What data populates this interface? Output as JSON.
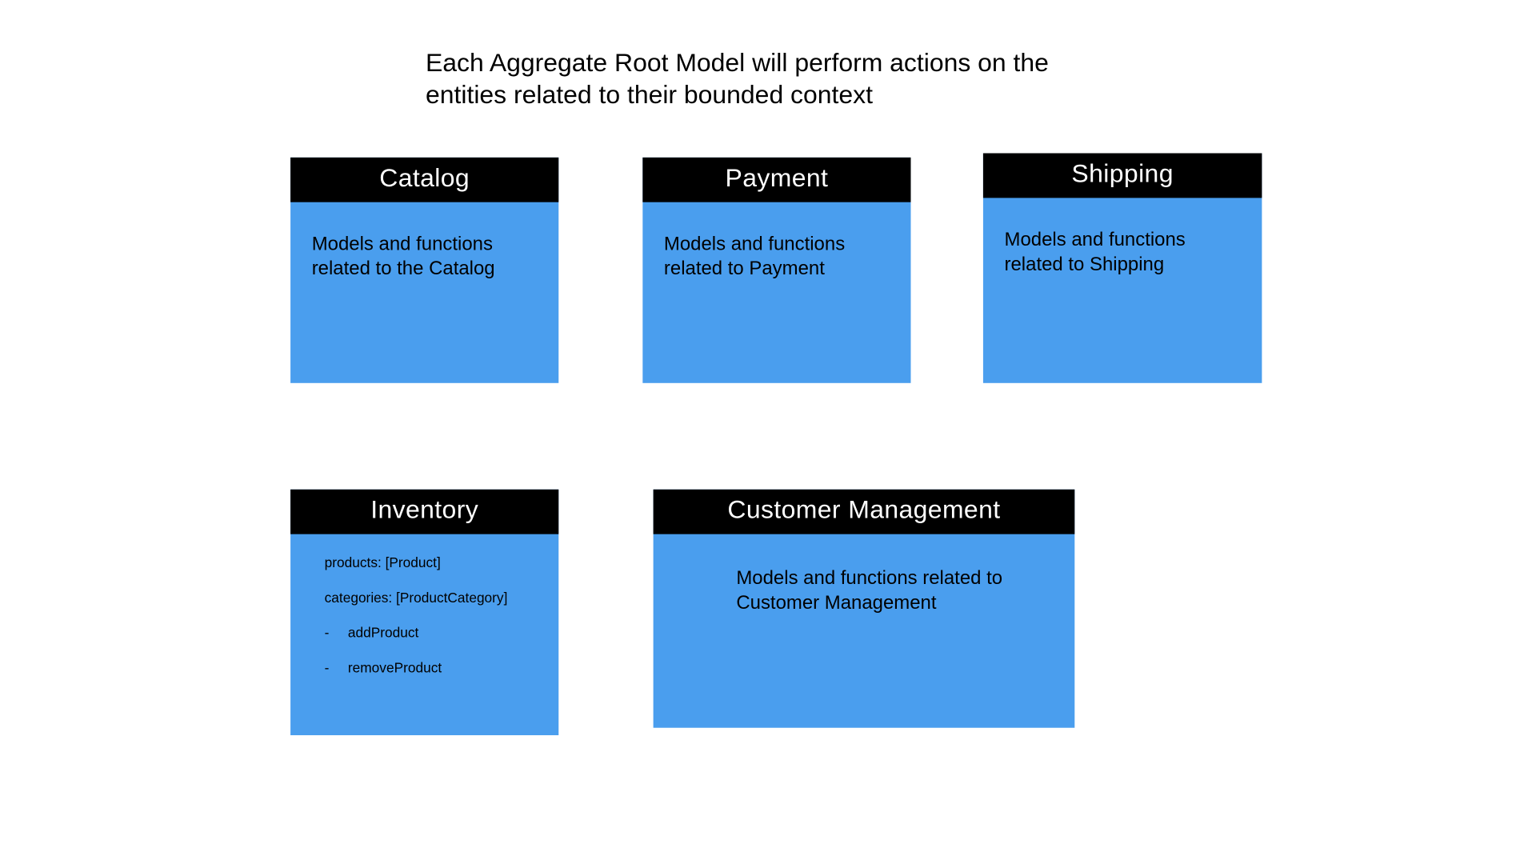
{
  "title": "Each Aggregate Root Model will perform actions on the entities related to their bounded context",
  "boxes": {
    "catalog": {
      "header": "Catalog",
      "body": "Models and functions related to the Catalog"
    },
    "payment": {
      "header": "Payment",
      "body": "Models and functions related to Payment"
    },
    "shipping": {
      "header": "Shipping",
      "body": "Models and functions related to Shipping"
    },
    "inventory": {
      "header": "Inventory",
      "rows": [
        {
          "text": "products: [Product]",
          "dash": false
        },
        {
          "text": "categories: [ProductCategory]",
          "dash": false
        },
        {
          "text": "addProduct",
          "dash": true
        },
        {
          "text": "removeProduct",
          "dash": true
        }
      ]
    },
    "customer": {
      "header": "Customer Management",
      "body": "Models and functions related to Customer Management"
    }
  }
}
